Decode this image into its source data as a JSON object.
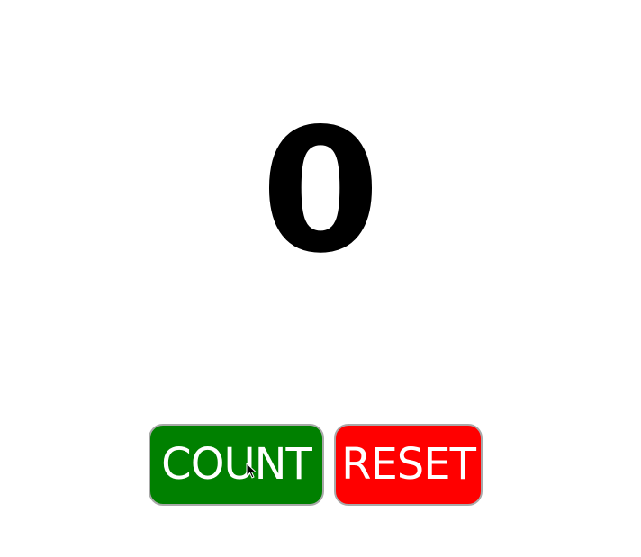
{
  "counter": {
    "value": "0"
  },
  "buttons": {
    "count_label": "COUNT",
    "count_color": "#008000",
    "reset_label": "RESET",
    "reset_color": "#ff0000"
  },
  "cursor": {
    "icon": "pointer-arrow-icon"
  }
}
